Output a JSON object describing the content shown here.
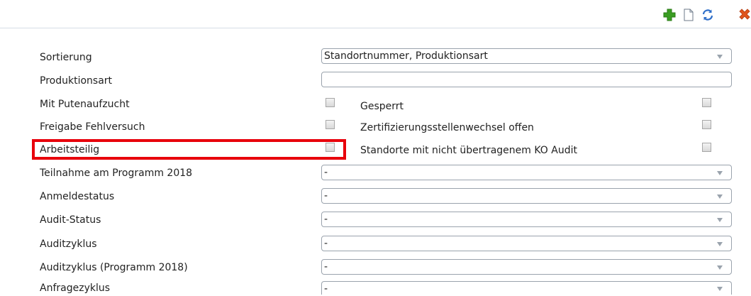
{
  "toolbar": {
    "icons": [
      "plus-icon",
      "new-document-icon",
      "refresh-icon",
      "delete-icon"
    ],
    "colors": {
      "add": "#3a9d23",
      "refresh": "#2f6fc9",
      "delete": "#e0541c"
    }
  },
  "form": {
    "sortierung": {
      "label": "Sortierung",
      "value": "Standortnummer, Produktionsart"
    },
    "produktionsart": {
      "label": "Produktionsart",
      "value": ""
    },
    "mit_putenaufzucht": {
      "label": "Mit Putenaufzucht",
      "checked": false
    },
    "freigabe_fehlversuch": {
      "label": "Freigabe Fehlversuch",
      "checked": false
    },
    "arbeitsteilig": {
      "label": "Arbeitsteilig",
      "checked": false
    },
    "gesperrt": {
      "label": "Gesperrt",
      "checked": false
    },
    "zertifizierungsstellenwechsel": {
      "label": "Zertifizierungsstellenwechsel offen",
      "checked": false
    },
    "ko_audit": {
      "label": "Standorte mit nicht übertragenem KO Audit",
      "checked": false
    },
    "teilnahme": {
      "label": "Teilnahme am Programm 2018",
      "value": "-"
    },
    "anmeldestatus": {
      "label": "Anmeldestatus",
      "value": "-"
    },
    "audit_status": {
      "label": "Audit-Status",
      "value": "-"
    },
    "auditzyklus": {
      "label": "Auditzyklus",
      "value": "-"
    },
    "auditzyklus_programm": {
      "label": "Auditzyklus (Programm 2018)",
      "value": "-"
    },
    "anfragezyklus": {
      "label": "Anfragezyklus",
      "value": "-"
    }
  },
  "highlight_color": "#e8000b"
}
